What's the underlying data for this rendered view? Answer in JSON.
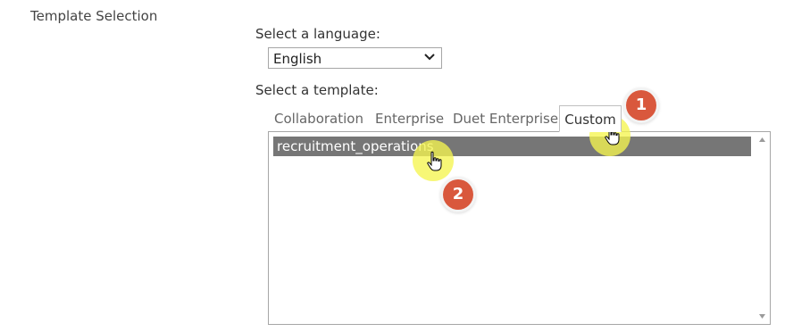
{
  "section": {
    "title": "Template Selection"
  },
  "language": {
    "label": "Select a language:",
    "selected": "English"
  },
  "template": {
    "label": "Select a template:",
    "tabs": [
      {
        "label": "Collaboration"
      },
      {
        "label": "Enterprise"
      },
      {
        "label": "Duet Enterprise"
      },
      {
        "label": "Custom"
      }
    ],
    "items": [
      {
        "label": "recruitment_operations"
      }
    ]
  },
  "steps": {
    "step1": "1",
    "step2": "2"
  },
  "colors": {
    "step_badge": "#d9583d",
    "highlight": "#f5f550",
    "selected_item": "#767676"
  },
  "icons": {
    "select_arrow": "chevron-down-icon",
    "cursor": "hand-pointer-icon",
    "scroll_up": "scroll-up-arrow-icon",
    "scroll_down": "scroll-down-arrow-icon"
  }
}
